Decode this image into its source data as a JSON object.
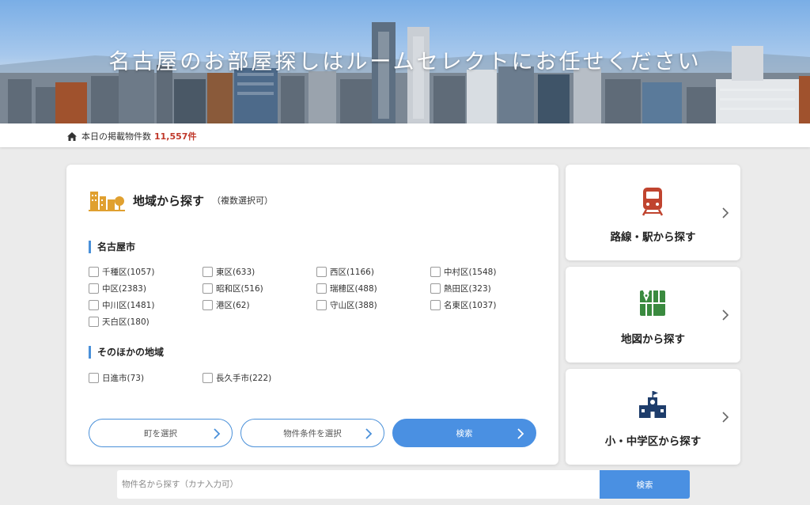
{
  "hero": {
    "title": "名古屋のお部屋探しはルームセレクトにお任せください"
  },
  "count_bar": {
    "label": "本日の掲載物件数",
    "count": "11,557件"
  },
  "area_search": {
    "title": "地域から探す",
    "subtitle": "（複数選択可）",
    "nagoya": {
      "label": "名古屋市",
      "wards": [
        "千種区(1057)",
        "東区(633)",
        "西区(1166)",
        "中村区(1548)",
        "中区(2383)",
        "昭和区(516)",
        "瑞穂区(488)",
        "熱田区(323)",
        "中川区(1481)",
        "港区(62)",
        "守山区(388)",
        "名東区(1037)",
        "天白区(180)"
      ]
    },
    "other": {
      "label": "そのほかの地域",
      "areas": [
        "日進市(73)",
        "長久手市(222)"
      ]
    },
    "buttons": {
      "town": "町を選択",
      "conditions": "物件条件を選択",
      "search": "検索"
    }
  },
  "side_links": [
    {
      "label": "路線・駅から探す",
      "icon": "train-icon",
      "color": "#c0442f"
    },
    {
      "label": "地図から探す",
      "icon": "map-icon",
      "color": "#3a8a3f"
    },
    {
      "label": "小・中学区から探す",
      "icon": "school-icon",
      "color": "#1e3d6b"
    }
  ],
  "name_search": {
    "placeholder": "物件名から探す（カナ入力可）",
    "button": "検索"
  },
  "colors": {
    "accent": "#4a90e2",
    "count": "#c0392b",
    "city_icon": "#e0a030"
  }
}
